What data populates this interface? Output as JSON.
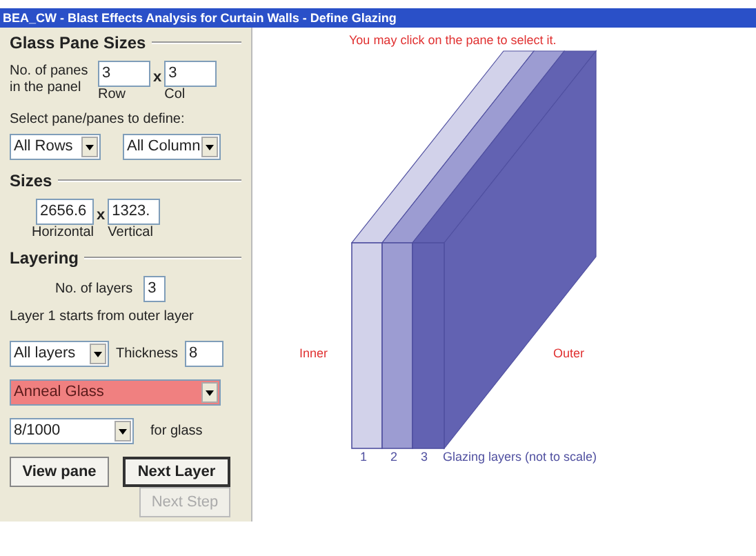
{
  "window": {
    "title": "BEA_CW - Blast Effects Analysis for Curtain Walls - Define Glazing"
  },
  "glass_pane_sizes": {
    "title": "Glass Pane Sizes",
    "panes_label": "No. of panes in the panel",
    "rows": {
      "value": "3",
      "caption": "Row"
    },
    "times": "x",
    "cols": {
      "value": "3",
      "caption": "Col"
    },
    "select_label": "Select pane/panes to define:",
    "row_select": "All Rows",
    "column_select": "All Column"
  },
  "sizes": {
    "title": "Sizes",
    "horizontal": {
      "value": "2656.6",
      "caption": "Horizontal"
    },
    "times": "x",
    "vertical": {
      "value": "1323.",
      "caption": "Vertical"
    }
  },
  "layering": {
    "title": "Layering",
    "layers_label": "No. of layers",
    "layers_value": "3",
    "note": "Layer 1 starts from outer layer",
    "layer_select": "All layers",
    "thickness_label": "Thickness",
    "thickness_value": "8",
    "glass_type": "Anneal Glass",
    "glass_type_highlighted": true,
    "ratio_select": "8/1000",
    "ratio_label": "for glass"
  },
  "buttons": [
    {
      "label": "View pane",
      "disabled": false,
      "default": false
    },
    {
      "label": "Next Layer",
      "disabled": false,
      "default": true
    }
  ],
  "next_step": {
    "label": "Next Step",
    "disabled": true
  },
  "canvas": {
    "message": "You may click on the pane to select it.",
    "inner_label": "Inner",
    "outer_label": "Outer",
    "layer_numbers": [
      "1",
      "2",
      "3"
    ],
    "caption": "Glazing layers (not to scale)"
  }
}
